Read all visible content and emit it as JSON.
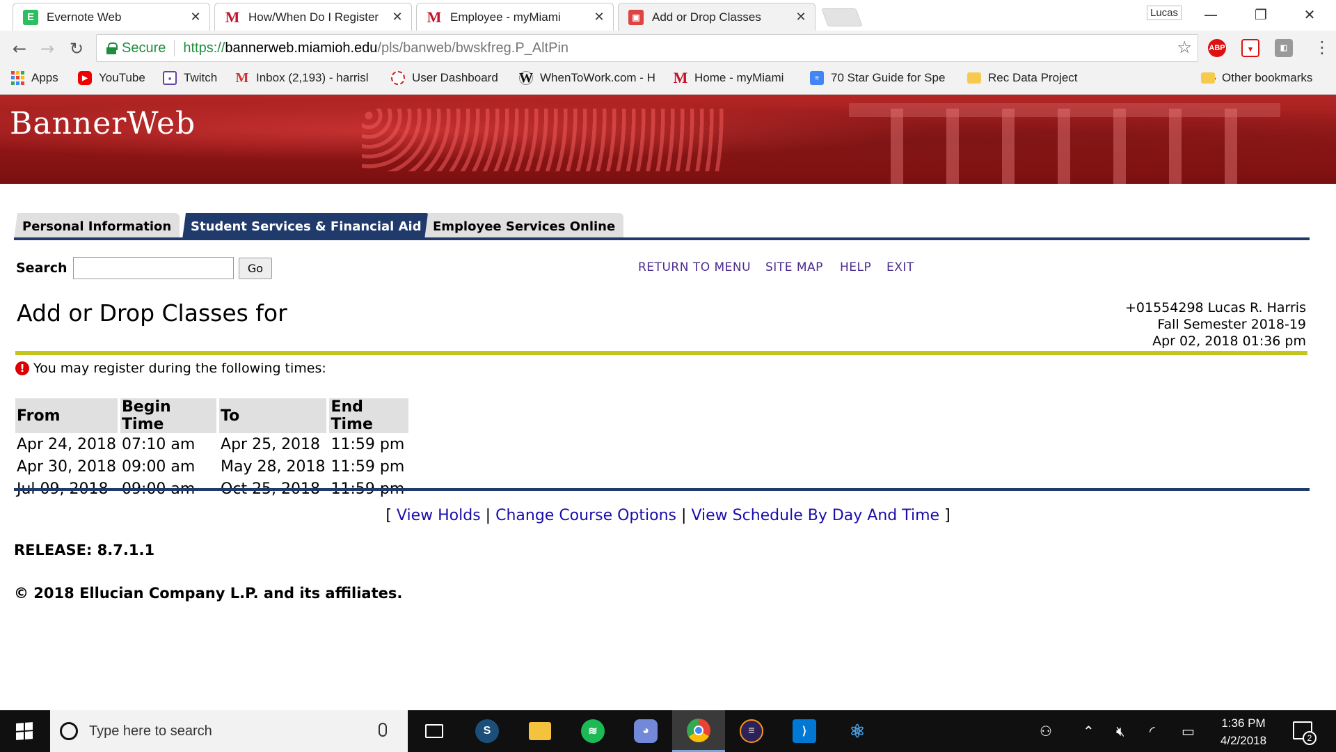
{
  "browser": {
    "tabs": [
      {
        "title": "Evernote Web",
        "favicon": "evernote-icon"
      },
      {
        "title": "How/When Do I Register",
        "favicon": "miami-m-icon"
      },
      {
        "title": "Employee - myMiami",
        "favicon": "miami-m-icon"
      },
      {
        "title": "Add or Drop Classes",
        "favicon": "bannerweb-icon"
      }
    ],
    "profile_name": "Lucas",
    "omnibox": {
      "secure_label": "Secure",
      "url_scheme": "https://",
      "url_host": "bannerweb.miamioh.edu",
      "url_path": "/pls/banweb/bwskfreg.P_AltPin"
    },
    "extensions": [
      "ABP"
    ],
    "bookmarks": [
      {
        "label": "Apps",
        "icon": "apps-grid-icon"
      },
      {
        "label": "YouTube",
        "icon": "youtube-icon"
      },
      {
        "label": "Twitch",
        "icon": "twitch-icon"
      },
      {
        "label": "Inbox (2,193) - harrisl",
        "icon": "gmail-icon"
      },
      {
        "label": "User Dashboard",
        "icon": "dashboard-icon"
      },
      {
        "label": "WhenToWork.com - H",
        "icon": "whentowork-icon"
      },
      {
        "label": "Home - myMiami",
        "icon": "miami-m-icon"
      },
      {
        "label": "70 Star Guide for Spe",
        "icon": "google-doc-icon"
      },
      {
        "label": "Rec Data Project",
        "icon": "folder-icon"
      }
    ],
    "bookmarks_more": "»",
    "other_bookmarks": "Other bookmarks"
  },
  "page": {
    "banner_title": "BannerWeb",
    "nav_tabs": [
      "Personal Information",
      "Student Services & Financial Aid",
      "Employee Services Online"
    ],
    "active_tab_index": 1,
    "search_label": "Search",
    "search_value": "",
    "go_label": "Go",
    "top_links": [
      "RETURN TO MENU",
      "SITE MAP",
      "HELP",
      "EXIT"
    ],
    "title": "Add or Drop Classes for",
    "user": {
      "id_name": "+01554298 Lucas R. Harris",
      "term": "Fall Semester 2018-19",
      "timestamp": "Apr 02, 2018 01:36 pm"
    },
    "notice": "You may register during the following times:",
    "times_table": {
      "headers": [
        "From",
        "Begin Time",
        "To",
        "End Time"
      ],
      "rows": [
        [
          "Apr 24, 2018",
          "07:10 am",
          "Apr 25, 2018",
          "11:59 pm"
        ],
        [
          "Apr 30, 2018",
          "09:00 am",
          "May 28, 2018",
          "11:59 pm"
        ],
        [
          "Jul 09, 2018",
          "09:00 am",
          "Oct 25, 2018",
          "11:59 pm"
        ]
      ]
    },
    "footer_links": [
      "View Holds",
      "Change Course Options",
      "View Schedule By Day And Time"
    ],
    "footer_bracket_open": "[",
    "footer_bracket_close": "]",
    "footer_sep": "|",
    "release": "RELEASE: 8.7.1.1",
    "copyright": "© 2018 Ellucian Company L.P. and its affiliates."
  },
  "taskbar": {
    "search_placeholder": "Type here to search",
    "apps": [
      "task-view",
      "steam",
      "file-explorer",
      "spotify",
      "discord",
      "chrome",
      "eclipse",
      "vscode",
      "atom"
    ],
    "active_app": "chrome",
    "time": "1:36 PM",
    "date": "4/2/2018",
    "notification_count": "2"
  }
}
